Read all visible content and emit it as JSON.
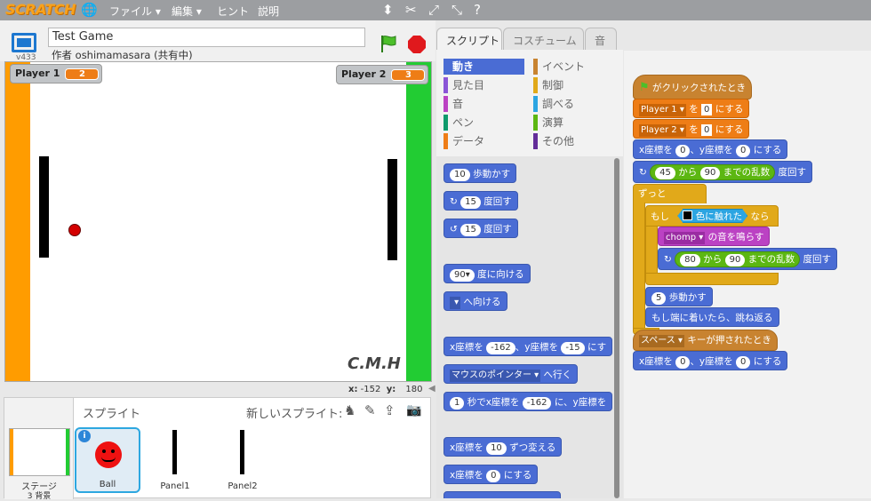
{
  "topbar": {
    "logo": "SCRATCH",
    "menus": [
      "ファイル ▾",
      "編集 ▾",
      "ヒント",
      "説明"
    ]
  },
  "stage_header": {
    "version": "v433",
    "project_title": "Test Game",
    "author": "作者 oshimamasara (共有中)"
  },
  "stage": {
    "variables": [
      {
        "name": "Player 1",
        "value": "2"
      },
      {
        "name": "Player 2",
        "value": "3"
      }
    ],
    "signature": "C.M.H",
    "coords": {
      "x_label": "x:",
      "x": "-152",
      "y_label": "y:",
      "y": "180"
    },
    "colors": {
      "left_wall": "#ff9c00",
      "right_wall": "#22cc33"
    }
  },
  "sprite_pane": {
    "title": "スプライト",
    "new_sprite": "新しいスプライト:",
    "stage_label": "ステージ",
    "backdrops": "3 背景",
    "sprites": [
      "Ball",
      "Panel1",
      "Panel2"
    ]
  },
  "tabs": [
    "スクリプト",
    "コスチューム",
    "音"
  ],
  "categories": {
    "left": [
      "動き",
      "見た目",
      "音",
      "ペン",
      "データ"
    ],
    "right": [
      "イベント",
      "制御",
      "調べる",
      "演算",
      "その他"
    ]
  },
  "palette": {
    "move": "10",
    "move_label": "歩動かす",
    "turn_r": "15",
    "turn_label": "度回す",
    "turn_l": "15",
    "point_dir": "90▾",
    "point_dir_label": "度に向ける",
    "point_toward_label": "へ向ける",
    "goto_xy_a": "x座標を",
    "goto_x": "-162",
    "goto_xy_b": "、y座標を",
    "goto_y": "-15",
    "goto_xy_c": "にす",
    "goto_target": "マウスのポインター ▾",
    "goto_label": "へ行く",
    "glide_sec": "1",
    "glide_a": "秒でx座標を",
    "glide_x": "-162",
    "glide_b": "に、y座標を",
    "changex_a": "x座標を",
    "changex_val": "10",
    "changex_b": "ずつ変える",
    "setx_a": "x座標を",
    "setx_val": "0",
    "setx_b": "にする"
  },
  "script": {
    "hat1": "がクリックされたとき",
    "set1_var": "Player 1 ▾",
    "set1_a": "を",
    "set1_val": "0",
    "set1_b": "にする",
    "set2_var": "Player 2 ▾",
    "set2_a": "を",
    "set2_val": "0",
    "set2_b": "にする",
    "goto_a": "x座標を",
    "goto_x": "0",
    "goto_b": "、y座標を",
    "goto_y": "0",
    "goto_c": "にする",
    "rand1_lo": "45",
    "rand1_from": "から",
    "rand1_hi": "90",
    "rand1_to": "までの乱数",
    "rand1_label": "度回す",
    "forever": "ずっと",
    "if": "もし",
    "touch_color": "色に触れた",
    "then": "なら",
    "sound": "chomp ▾",
    "sound_label": "の音を鳴らす",
    "rand2_lo": "80",
    "rand2_from": "から",
    "rand2_hi": "90",
    "rand2_to": "までの乱数",
    "rand2_label": "度回す",
    "move_val": "5",
    "move_label": "歩動かす",
    "bounce": "もし端に着いたら、跳ね返る",
    "hat2_key": "スペース ▾",
    "hat2_label": "キーが押されたとき",
    "goto2_a": "x座標を",
    "goto2_x": "0",
    "goto2_b": "、y座標を",
    "goto2_y": "0",
    "goto2_c": "にする"
  }
}
